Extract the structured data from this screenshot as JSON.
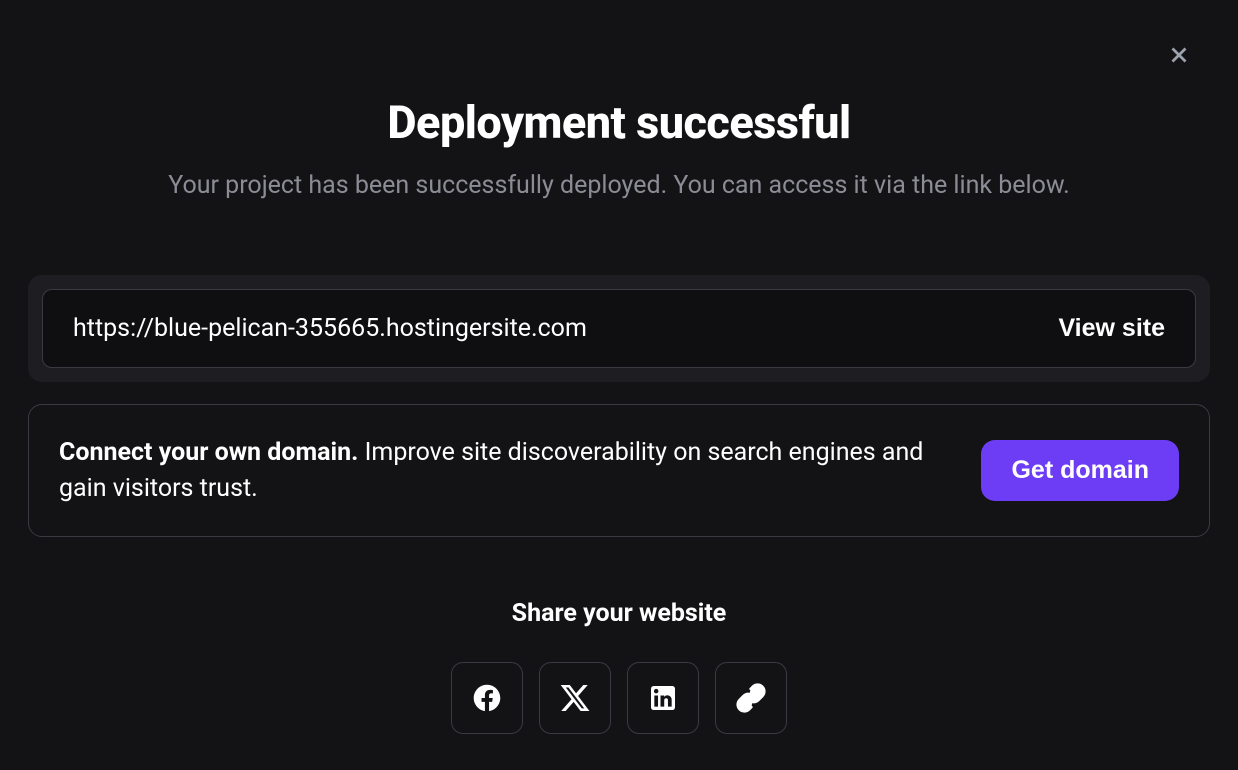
{
  "header": {
    "title": "Deployment successful",
    "subtitle": "Your project has been successfully deployed. You can access it via the link below."
  },
  "deployment": {
    "url": "https://blue-pelican-355665.hostingersite.com",
    "view_label": "View site"
  },
  "domain": {
    "bold_text": "Connect your own domain.",
    "description": " Improve site discoverability on search engines and gain visitors trust.",
    "button_label": "Get domain"
  },
  "share": {
    "title": "Share your website",
    "icons": {
      "facebook": "facebook-icon",
      "x": "x-twitter-icon",
      "linkedin": "linkedin-icon",
      "link": "copy-link-icon"
    }
  },
  "colors": {
    "background": "#131316",
    "card_bg": "#1e1e22",
    "inner_bg": "#0f0f11",
    "border": "#3a3a42",
    "text_muted": "#8c8c96",
    "accent": "#6d3df5"
  }
}
